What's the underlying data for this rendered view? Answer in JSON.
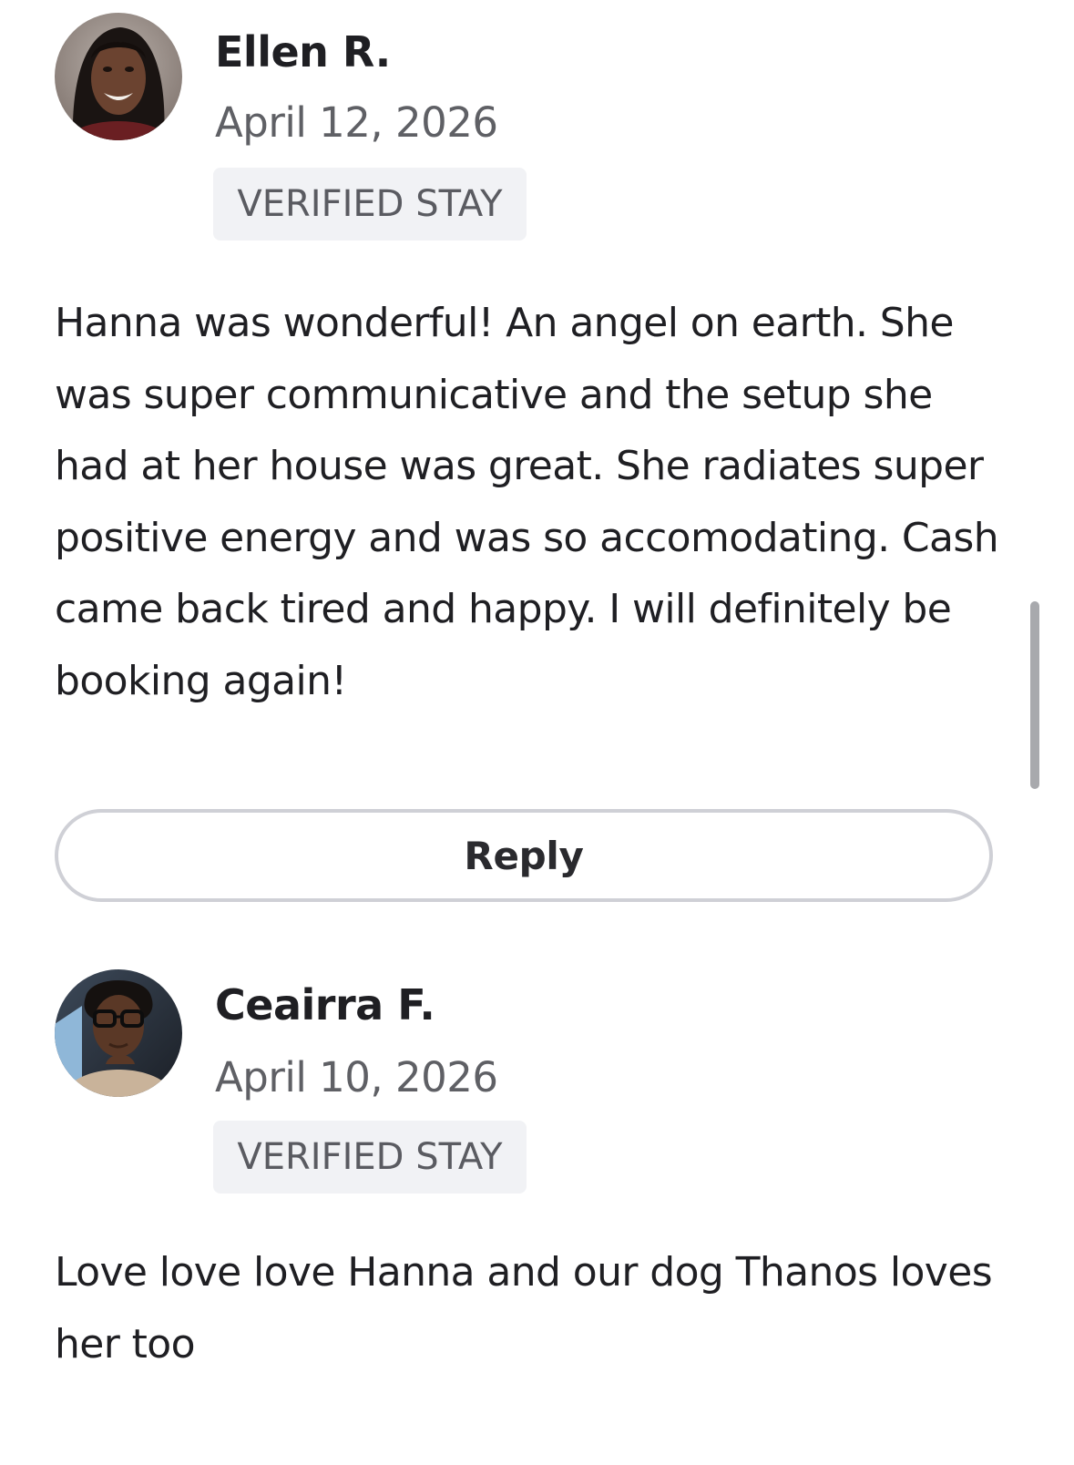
{
  "reviews": [
    {
      "reviewer_name": "Ellen R.",
      "date": "April 12, 2026",
      "badge": "VERIFIED STAY",
      "avatar_icon": "person-photo-avatar",
      "text": "Hanna was wonderful! An angel on earth. She was super communicative and the setup she had at her house was great. She radiates super positive energy and was so accomodating. Cash came back tired and happy. I will definitely be booking again!",
      "reply_label": "Reply"
    },
    {
      "reviewer_name": "Ceairra F.",
      "date": "April 10, 2026",
      "badge": "VERIFIED STAY",
      "avatar_icon": "person-photo-avatar",
      "text": "Love love love Hanna and our dog Thanos loves her too"
    }
  ],
  "colors": {
    "text_primary": "#1f1f23",
    "text_secondary": "#5f6065",
    "badge_background": "#f1f2f5",
    "button_border": "#cfd0d6",
    "scrollbar": "#a8a9ad"
  }
}
